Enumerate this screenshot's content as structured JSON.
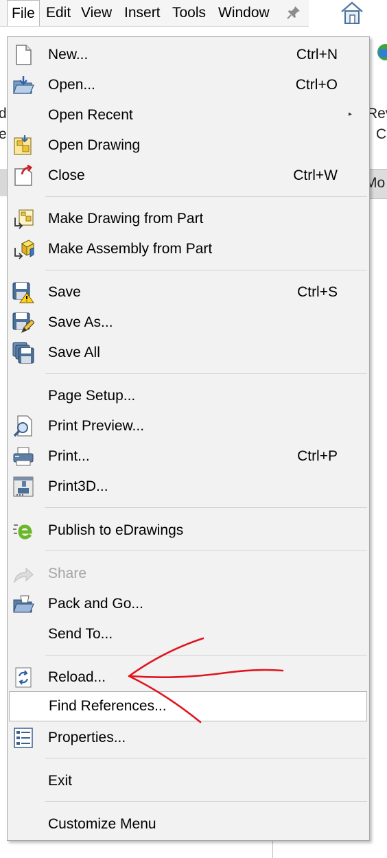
{
  "menubar": {
    "items": [
      "File",
      "Edit",
      "View",
      "Insert",
      "Tools",
      "Window"
    ],
    "active_item": "File"
  },
  "background": {
    "fragment_d": "d",
    "fragment_e": "e",
    "fragment_rev": "Rev",
    "fragment_c": "C",
    "fragment_mo": "Mo"
  },
  "file_menu": {
    "items": [
      {
        "label": "New...",
        "shortcut": "Ctrl+N",
        "icon": "new-document-icon"
      },
      {
        "label": "Open...",
        "shortcut": "Ctrl+O",
        "icon": "open-folder-icon"
      },
      {
        "label": "Open Recent",
        "shortcut": "",
        "submenu": true
      },
      {
        "label": "Open Drawing",
        "shortcut": "",
        "icon": "open-drawing-icon"
      },
      {
        "label": "Close",
        "shortcut": "Ctrl+W",
        "icon": "close-document-icon"
      },
      {
        "label": "Make Drawing from Part",
        "shortcut": "",
        "icon": "make-drawing-icon"
      },
      {
        "label": "Make Assembly from Part",
        "shortcut": "",
        "icon": "make-assembly-icon"
      },
      {
        "label": "Save",
        "shortcut": "Ctrl+S",
        "icon": "save-warning-icon"
      },
      {
        "label": "Save As...",
        "shortcut": "",
        "icon": "save-as-icon"
      },
      {
        "label": "Save All",
        "shortcut": "",
        "icon": "save-all-icon"
      },
      {
        "label": "Page Setup...",
        "shortcut": ""
      },
      {
        "label": "Print Preview...",
        "shortcut": "",
        "icon": "print-preview-icon"
      },
      {
        "label": "Print...",
        "shortcut": "Ctrl+P",
        "icon": "printer-icon"
      },
      {
        "label": "Print3D...",
        "shortcut": "",
        "icon": "print3d-icon"
      },
      {
        "label": "Publish to eDrawings",
        "shortcut": "",
        "icon": "edrawings-icon"
      },
      {
        "label": "Share",
        "shortcut": "",
        "icon": "share-icon",
        "disabled": true
      },
      {
        "label": "Pack and Go...",
        "shortcut": "",
        "icon": "pack-and-go-icon"
      },
      {
        "label": "Send To...",
        "shortcut": ""
      },
      {
        "label": "Reload...",
        "shortcut": "",
        "icon": "reload-icon"
      },
      {
        "label": "Find References...",
        "shortcut": "",
        "highlighted": true
      },
      {
        "label": "Properties...",
        "shortcut": "",
        "icon": "properties-icon"
      },
      {
        "label": "Exit",
        "shortcut": ""
      },
      {
        "label": "Customize Menu",
        "shortcut": ""
      }
    ]
  },
  "annotation": {
    "color": "#e0141e",
    "type": "hand-drawn-arrow",
    "points_to": "Reload..."
  },
  "colors": {
    "menu_bg": "#f2f2f2",
    "highlight_bg": "#ffffff",
    "disabled_text": "#a5a5a5"
  }
}
